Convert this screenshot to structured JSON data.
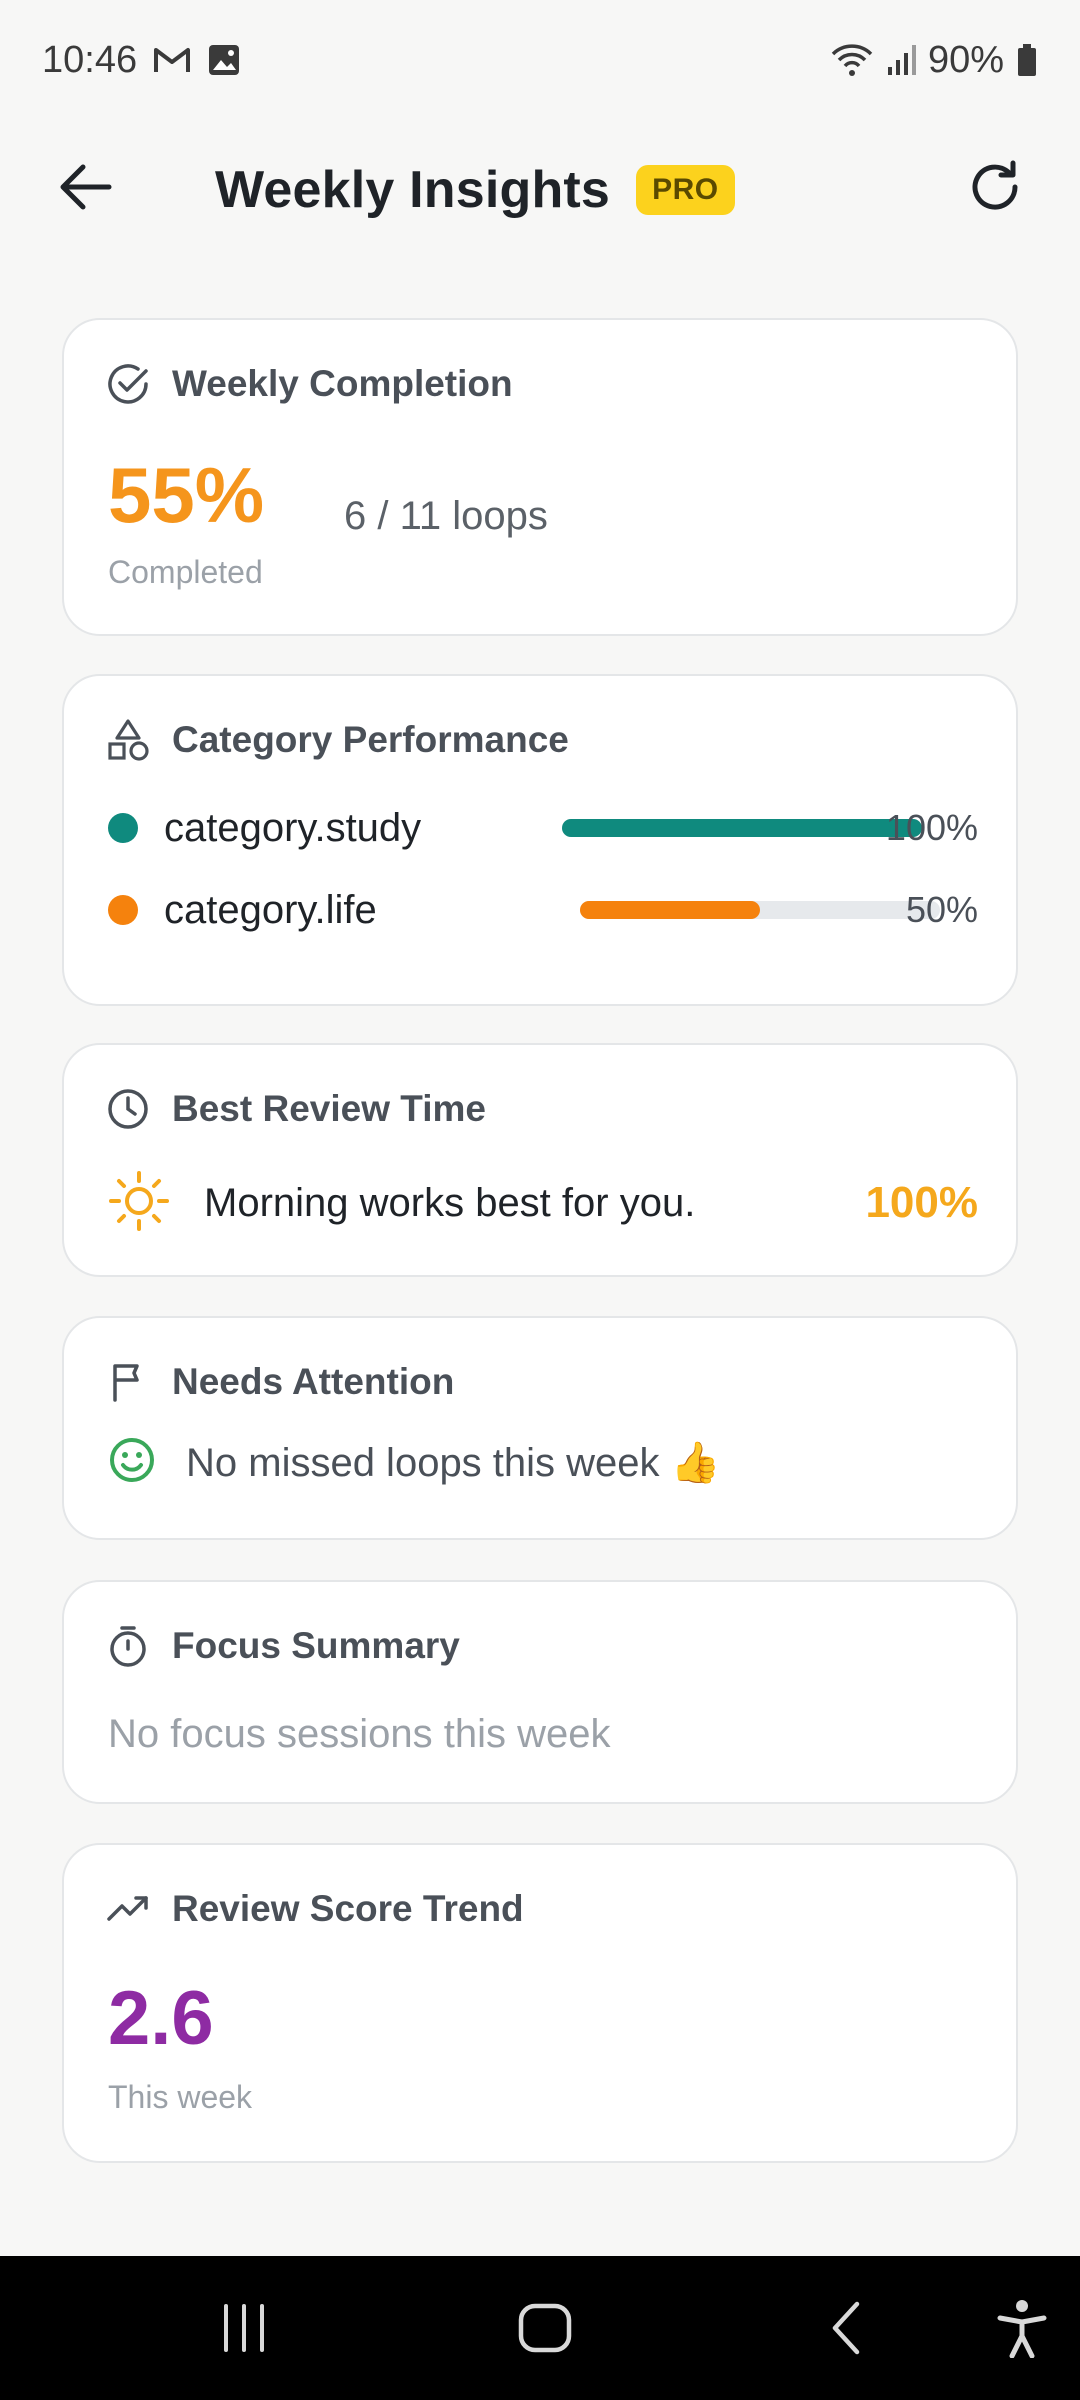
{
  "status_bar": {
    "time": "10:46",
    "battery": "90%",
    "icons": [
      "gmail-icon",
      "gallery-icon",
      "wifi-icon",
      "signal-icon",
      "battery-icon"
    ]
  },
  "app_bar": {
    "title": "Weekly Insights",
    "badge": "PRO",
    "icons": [
      "back-arrow-icon",
      "refresh-icon"
    ]
  },
  "weekly_completion": {
    "title": "Weekly Completion",
    "percent": "55%",
    "percent_label": "Completed",
    "loops": "6 / 11 loops",
    "icon": "check-circle-icon"
  },
  "category_performance": {
    "title": "Category Performance",
    "icon": "shapes-icon",
    "items": [
      {
        "label": "category.study",
        "percent": "100%",
        "value": 1.0,
        "color": "#0f8a7e"
      },
      {
        "label": "category.life",
        "percent": "50%",
        "value": 0.5,
        "color": "#f5820d"
      }
    ]
  },
  "best_review_time": {
    "title": "Best Review Time",
    "icon": "clock-icon",
    "message": "Morning works best for you.",
    "percent": "100%",
    "message_icon": "sun-icon"
  },
  "needs_attention": {
    "title": "Needs Attention",
    "icon": "flag-icon",
    "message": "No missed loops this week 👍",
    "message_icon": "smiley-icon"
  },
  "focus_summary": {
    "title": "Focus Summary",
    "icon": "timer-icon",
    "message": "No focus sessions this week"
  },
  "review_score_trend": {
    "title": "Review Score Trend",
    "icon": "trend-up-icon",
    "score": "2.6",
    "score_label": "This week"
  },
  "nav_bar": {
    "icons": [
      "recents-icon",
      "home-icon",
      "back-icon",
      "accessibility-icon"
    ]
  },
  "colors": {
    "accent_orange": "#f5951c",
    "teal": "#0f8a7e",
    "purple": "#8e2ba3",
    "pro_yellow": "#fcd21d"
  }
}
